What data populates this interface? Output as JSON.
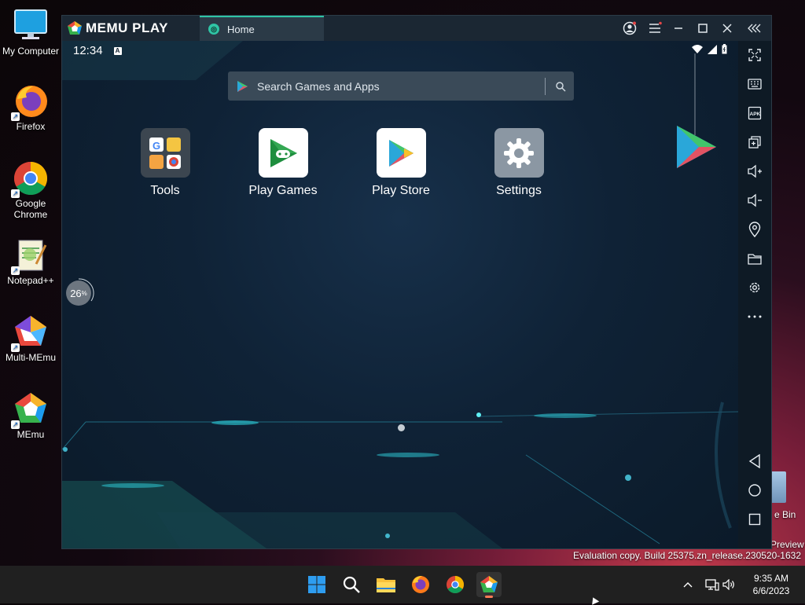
{
  "desktop": {
    "icons": [
      {
        "label": "My Computer"
      },
      {
        "label": "Firefox"
      },
      {
        "label": "Google Chrome"
      },
      {
        "label": "Notepad++"
      },
      {
        "label": "Multi-MEmu"
      },
      {
        "label": "MEmu"
      }
    ],
    "recycle_bin_partial": "e Bin",
    "preview_partial": "Preview",
    "evaluation_text": "Evaluation copy. Build 25375.zn_release.230520-1632"
  },
  "emulator": {
    "brand": "MEMU PLAY",
    "tab_label": "Home",
    "status_time": "12:34",
    "search_placeholder": "Search Games and Apps",
    "apps": [
      {
        "label": "Tools"
      },
      {
        "label": "Play Games"
      },
      {
        "label": "Play Store"
      },
      {
        "label": "Settings"
      }
    ],
    "progress_value": "26",
    "progress_unit": "%",
    "sidebar_icons": [
      "fullscreen-icon",
      "keyboard-icon",
      "apk-icon",
      "multi-window-icon",
      "volume-up-icon",
      "volume-down-icon",
      "location-icon",
      "folder-icon",
      "settings-icon",
      "more-icon",
      "back-icon",
      "home-icon",
      "recents-icon"
    ],
    "colors": {
      "accent": "#2fc4a5",
      "titlebar": "#1b2733",
      "screen": "#0f2236"
    }
  },
  "taskbar": {
    "time": "9:35 AM",
    "date": "6/6/2023",
    "items": [
      "start-icon",
      "search-icon",
      "file-explorer-icon",
      "firefox-icon",
      "chrome-icon",
      "memu-icon"
    ]
  }
}
